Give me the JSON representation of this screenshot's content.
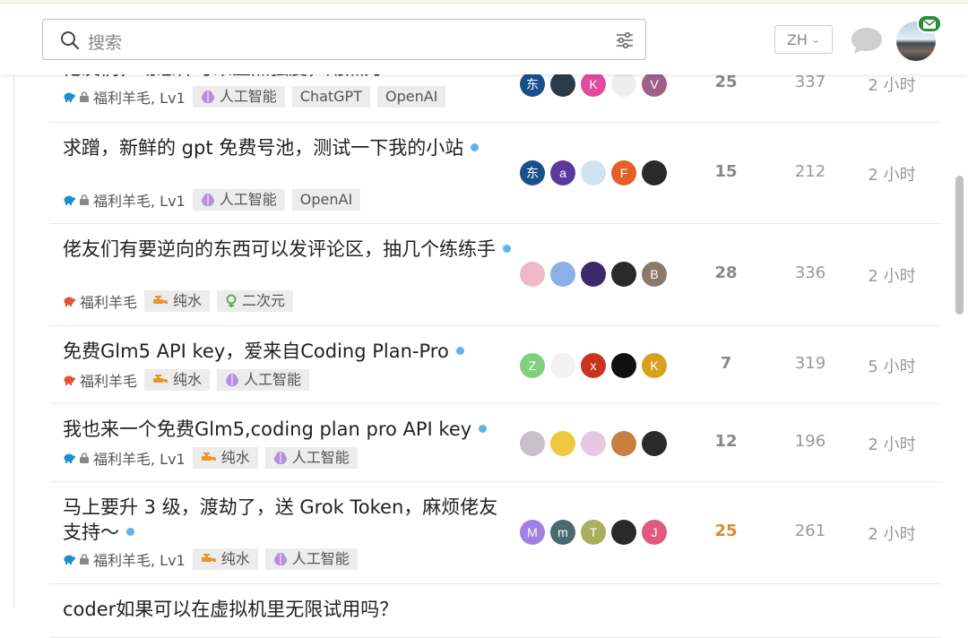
{
  "search": {
    "placeholder": "搜索"
  },
  "header": {
    "lang": "ZH"
  },
  "topics": [
    {
      "title": "佬友们，动态样与来上点强度，用点力",
      "category": "福利羊毛, Lv1",
      "cat_color": "#1a8fd0",
      "locked": true,
      "tags": [
        "人工智能",
        "ChatGPT",
        "OpenAI"
      ],
      "posters": [
        {
          "t": "东",
          "c": "#1a4f8a"
        },
        {
          "t": "",
          "c": "#2c3b4a"
        },
        {
          "t": "K",
          "c": "#e04aa0"
        },
        {
          "t": "",
          "c": "#eee"
        },
        {
          "t": "V",
          "c": "#a0608a"
        }
      ],
      "replies": "25",
      "views": "337",
      "activity": "2 小时"
    },
    {
      "title": "求蹭，新鲜的 gpt 免费号池，测试一下我的小站",
      "category": "福利羊毛, Lv1",
      "cat_color": "#1a8fd0",
      "locked": true,
      "tags": [
        "人工智能",
        "OpenAI"
      ],
      "posters": [
        {
          "t": "东",
          "c": "#1a4f8a"
        },
        {
          "t": "a",
          "c": "#5a3aa0"
        },
        {
          "t": "",
          "c": "#cfe3f0"
        },
        {
          "t": "F",
          "c": "#e4602a"
        },
        {
          "t": "",
          "c": "#2a2a2a"
        }
      ],
      "replies": "15",
      "views": "212",
      "activity": "2 小时"
    },
    {
      "title": "佬友们有要逆向的东西可以发评论区，抽几个练练手",
      "category": "福利羊毛",
      "cat_color": "#e0523a",
      "locked": false,
      "tags": [
        "纯水",
        "二次元"
      ],
      "posters": [
        {
          "t": "",
          "c": "#f0b8c8"
        },
        {
          "t": "",
          "c": "#8ab0e8"
        },
        {
          "t": "",
          "c": "#3a2a6a"
        },
        {
          "t": "",
          "c": "#2a2a2a"
        },
        {
          "t": "B",
          "c": "#8a7a6a"
        }
      ],
      "replies": "28",
      "views": "336",
      "activity": "2 小时"
    },
    {
      "title": "免费Glm5 API key，爱来自Coding Plan-Pro",
      "category": "福利羊毛",
      "cat_color": "#e0523a",
      "locked": false,
      "tags": [
        "纯水",
        "人工智能"
      ],
      "posters": [
        {
          "t": "Z",
          "c": "#7ed07e"
        },
        {
          "t": "",
          "c": "#f2f2f2"
        },
        {
          "t": "x",
          "c": "#c8341e"
        },
        {
          "t": "",
          "c": "#111"
        },
        {
          "t": "K",
          "c": "#d8a020"
        }
      ],
      "replies": "7",
      "views": "319",
      "activity": "5 小时"
    },
    {
      "title": "我也来一个免费Glm5,coding plan pro API key",
      "category": "福利羊毛, Lv1",
      "cat_color": "#1a8fd0",
      "locked": true,
      "tags": [
        "纯水",
        "人工智能"
      ],
      "posters": [
        {
          "t": "",
          "c": "#c8c0c8"
        },
        {
          "t": "",
          "c": "#f0c840"
        },
        {
          "t": "",
          "c": "#e8c8e0"
        },
        {
          "t": "",
          "c": "#c88040"
        },
        {
          "t": "",
          "c": "#2a2a2a"
        }
      ],
      "replies": "12",
      "views": "196",
      "activity": "2 小时"
    },
    {
      "title": "马上要升 3 级，渡劫了，送 Grok Token，麻烦佬友支持～",
      "category": "福利羊毛, Lv1",
      "cat_color": "#1a8fd0",
      "locked": true,
      "tags": [
        "纯水",
        "人工智能"
      ],
      "posters": [
        {
          "t": "M",
          "c": "#a080e0"
        },
        {
          "t": "m",
          "c": "#4a6a70"
        },
        {
          "t": "T",
          "c": "#a8b060"
        },
        {
          "t": "",
          "c": "#2a2a2a"
        },
        {
          "t": "J",
          "c": "#e05a80"
        }
      ],
      "replies": "25",
      "views": "261",
      "activity": "2 小时",
      "hot": true
    },
    {
      "title": "coder如果可以在虚拟机里无限试用吗？",
      "category": "",
      "cat_color": "#1a8fd0",
      "locked": false,
      "tags": [],
      "posters": [],
      "replies": "",
      "views": "",
      "activity": ""
    }
  ]
}
